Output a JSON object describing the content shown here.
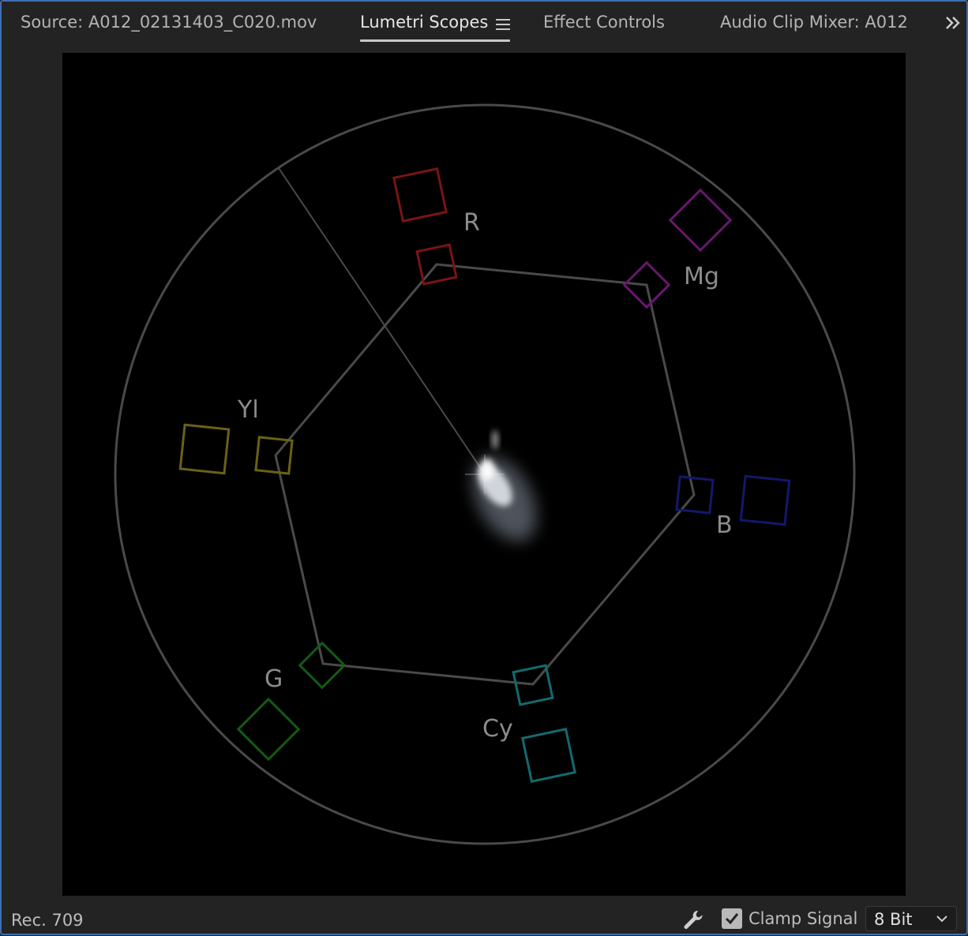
{
  "tabs": [
    {
      "label": "Source: A012_02131403_C020.mov",
      "active": false
    },
    {
      "label": "Lumetri Scopes",
      "active": true
    },
    {
      "label": "Effect Controls",
      "active": false
    },
    {
      "label": "Audio Clip Mixer: A012_",
      "active": false
    }
  ],
  "icons": {
    "menu": "hamburger-menu-icon",
    "overflow": "double-chevron-right-icon",
    "settings": "wrench-icon",
    "check": "checkmark-icon",
    "dropdown": "chevron-down-icon"
  },
  "vectorscope": {
    "targets": [
      {
        "label": "R",
        "color": "#7a1414"
      },
      {
        "label": "Mg",
        "color": "#6a1670"
      },
      {
        "label": "B",
        "color": "#14186a"
      },
      {
        "label": "Cy",
        "color": "#146a6e"
      },
      {
        "label": "G",
        "color": "#145a14"
      },
      {
        "label": "Yl",
        "color": "#6a6214"
      }
    ],
    "graticule_color": "#4a4a4a",
    "label_color": "#8c8c8c"
  },
  "footer": {
    "standard": "Rec. 709",
    "clamp_label": "Clamp Signal",
    "clamp_checked": true,
    "bit_depth": "8 Bit"
  }
}
